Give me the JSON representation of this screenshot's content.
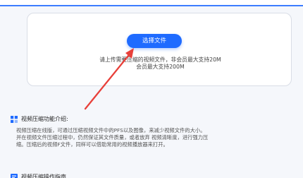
{
  "upload": {
    "button_label": "选择文件",
    "hint_line1": "请上传需要压缩的视频文件，非会员最大支持20M",
    "hint_line2": "会员最大支持200M"
  },
  "intro": {
    "icon": "grid-icon",
    "title": "视频压缩功能介绍:",
    "lines": [
      "视频压缩在线版，可通过压缩视频文件中的PFS以及图像，来减少视频文件的大小。",
      "并在视频文件压缩过程中，仍然保证其文件质量，或者放弃 视频清晰度，进行强力压",
      "缩。压缩后的视频F文件，同样可以借助常用的视频播放器来打开。"
    ]
  },
  "steps": {
    "icon": "document-icon",
    "title": "视频压缩操作指南"
  },
  "colors": {
    "accent": "#1f6bff",
    "arrow": "#e8403a"
  }
}
